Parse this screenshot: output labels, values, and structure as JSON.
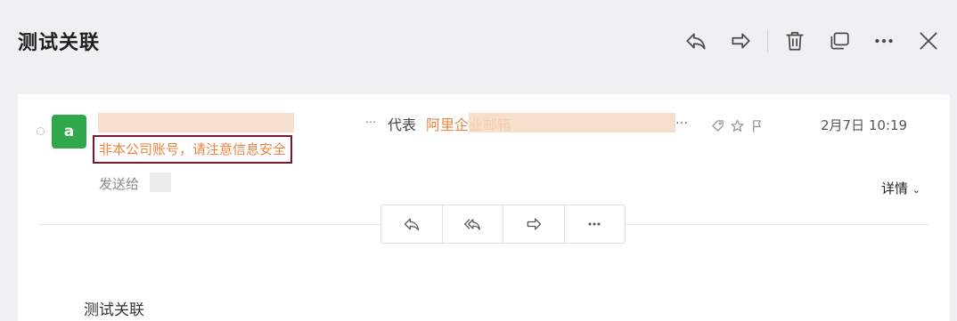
{
  "email": {
    "subject": "测试关联",
    "avatar_letter": "a",
    "on_behalf_label": "代表",
    "company_name": "阿里企业邮箱",
    "ellipsis_small": "…",
    "ellipsis_end": "…",
    "date": "2月7日 10:19",
    "warning": "非本公司账号，请注意信息安全",
    "sent_to_label": "发送给",
    "details_label": "详情",
    "body": "测试关联"
  },
  "colors": {
    "accent_orange": "#e8853e",
    "avatar_green": "#2ea84a",
    "warning_border": "#7a1626"
  },
  "icons": {
    "toolbar": [
      "reply-icon",
      "forward-icon",
      "trash-icon",
      "window-icon",
      "more-icon",
      "close-icon"
    ],
    "sender": [
      "tag-icon",
      "star-icon",
      "flag-icon"
    ],
    "actions": [
      "reply-icon",
      "reply-all-icon",
      "forward-icon",
      "more-icon"
    ]
  }
}
